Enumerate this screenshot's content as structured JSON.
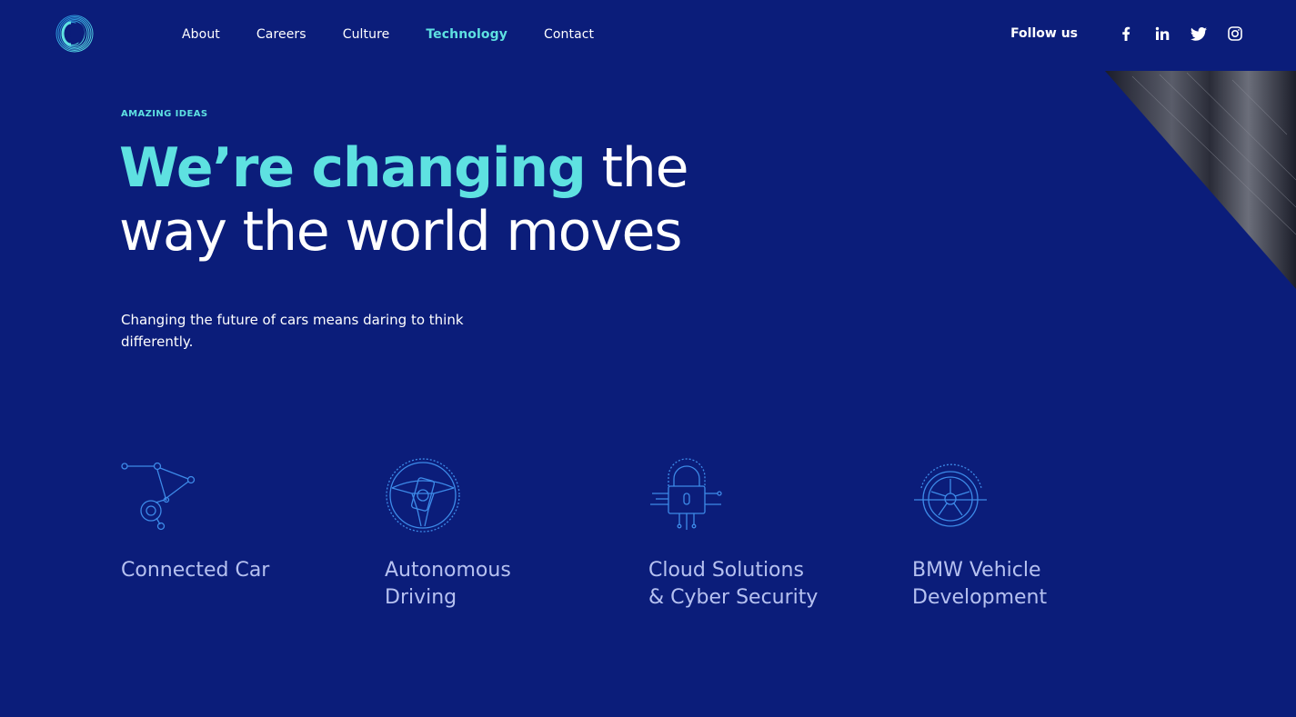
{
  "header": {
    "logo_icon": "swirl-logo-icon",
    "nav": [
      {
        "label": "About",
        "active": false
      },
      {
        "label": "Careers",
        "active": false
      },
      {
        "label": "Culture",
        "active": false
      },
      {
        "label": "Technology",
        "active": true
      },
      {
        "label": "Contact",
        "active": false
      }
    ],
    "follow_label": "Follow us",
    "social": [
      {
        "icon": "facebook-icon"
      },
      {
        "icon": "linkedin-icon"
      },
      {
        "icon": "twitter-icon"
      },
      {
        "icon": "instagram-icon"
      }
    ]
  },
  "hero": {
    "eyebrow": "AMAZING IDEAS",
    "headline_accent": "We’re changing",
    "headline_rest_line1": " the",
    "headline_line2": "way the world moves",
    "subtext": "Changing the future of cars means daring to think differently."
  },
  "features": [
    {
      "icon": "connected-network-icon",
      "label": "Connected Car"
    },
    {
      "icon": "steering-wheel-icon",
      "label": "Autonomous\nDriving"
    },
    {
      "icon": "padlock-circuit-icon",
      "label": "Cloud Solutions\n& Cyber Security"
    },
    {
      "icon": "wheel-rim-icon",
      "label": "BMW Vehicle\nDevelopment"
    }
  ],
  "colors": {
    "background": "#0b1d7a",
    "accent": "#5ee1e1",
    "text": "#ffffff",
    "muted_text": "#b6c1f0",
    "icon_stroke": "#3d8ae8"
  }
}
